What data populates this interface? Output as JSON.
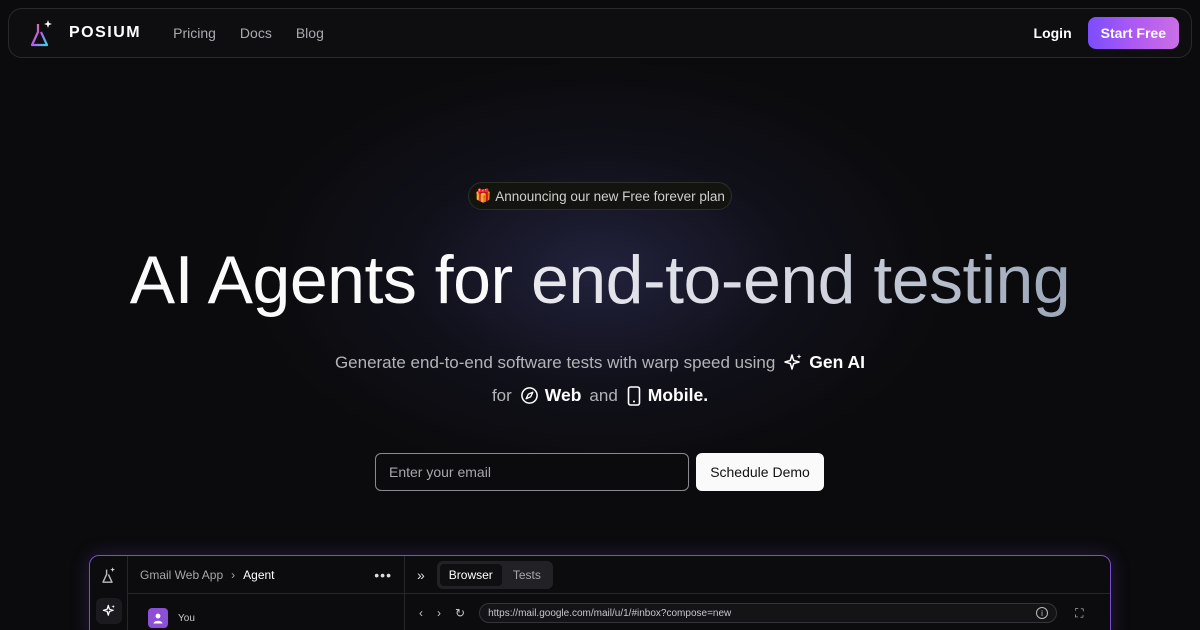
{
  "nav": {
    "brand": "POSIUM",
    "links": [
      "Pricing",
      "Docs",
      "Blog"
    ],
    "login": "Login",
    "cta": "Start Free"
  },
  "hero": {
    "announcement": "Announcing our new Free forever plan",
    "headline_a": "AI Agents for",
    "headline_b": "end-to-end testing",
    "sub_line1": "Generate end-to-end software tests with warp speed using",
    "gen_ai": "Gen AI",
    "sub_for": "for",
    "web": "Web",
    "sub_and": "and",
    "mobile": "Mobile."
  },
  "form": {
    "email_placeholder": "Enter your email",
    "email_value": "",
    "button": "Schedule Demo"
  },
  "preview": {
    "breadcrumb_1": "Gmail Web App",
    "breadcrumb_2": "Agent",
    "user_label": "You",
    "tabs": [
      "Browser",
      "Tests"
    ],
    "active_tab": "Browser",
    "url": "https://mail.google.com/mail/u/1/#inbox?compose=new"
  },
  "colors": {
    "accent_start": "#7c4dff",
    "accent_end": "#c96fe6",
    "background": "#0b0b0d"
  }
}
